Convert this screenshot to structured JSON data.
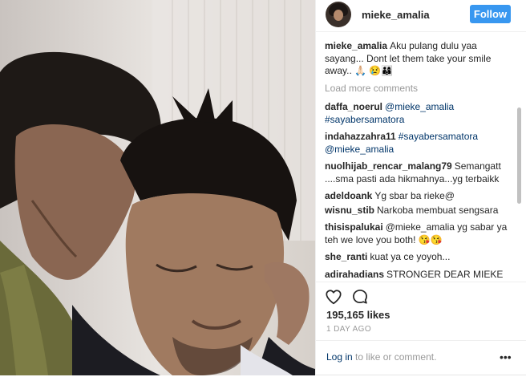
{
  "header": {
    "username": "mieke_amalia",
    "follow_label": "Follow"
  },
  "caption": {
    "username": "mieke_amalia",
    "text": "Aku pulang dulu yaa sayang... Dont let them take your smile away.. 🙏🏻 😢👨‍👩‍👦"
  },
  "load_more": "Load more comments",
  "comments": [
    {
      "username": "daffa_noerul",
      "text": "@mieke_amalia #sayabersamatora"
    },
    {
      "username": "indahazzahra11",
      "text": "#sayabersamatora @mieke_amalia"
    },
    {
      "username": "nuolhijab_rencar_malang79",
      "text": "Semangatt ....sma pasti ada hikmahnya...yg terbaikk"
    },
    {
      "username": "adeldoank",
      "text": "Yg sbar ba rieke@"
    },
    {
      "username": "wisnu_stib",
      "text": "Narkoba membuat sengsara"
    },
    {
      "username": "thisispalukai",
      "text": "@mieke_amalia yg sabar ya teh we love you both! 😘😘"
    },
    {
      "username": "she_ranti",
      "text": "kuat ya ce yoyoh..."
    },
    {
      "username": "adirahadians",
      "text": "STRONGER DEAR MIEKE"
    }
  ],
  "actions": {
    "heart_icon": "heart-outline-icon",
    "comment_icon": "comment-bubble-icon"
  },
  "likes": "195,165 likes",
  "time_ago": "1 DAY AGO",
  "footer": {
    "login_label": "Log in",
    "rest": "to like or comment.",
    "more_label": "•••"
  },
  "colors": {
    "follow_button": "#3897f0",
    "link": "#003569",
    "muted": "#999999"
  }
}
